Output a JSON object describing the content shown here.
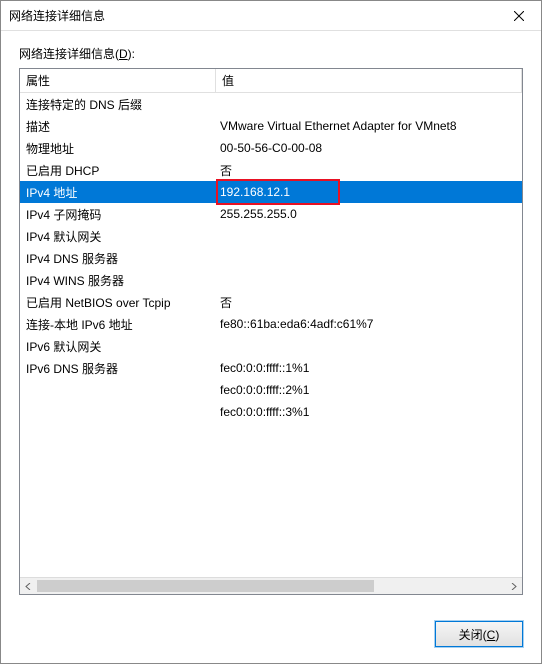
{
  "window": {
    "title": "网络连接详细信息",
    "close_label": "Close"
  },
  "label": {
    "text_pre": "网络连接详细信息(",
    "text_key": "D",
    "text_post": "):"
  },
  "columns": {
    "property": "属性",
    "value": "值"
  },
  "rows": [
    {
      "prop": "连接特定的 DNS 后缀",
      "val": "",
      "selected": false
    },
    {
      "prop": "描述",
      "val": "VMware Virtual Ethernet Adapter for VMnet8",
      "selected": false
    },
    {
      "prop": "物理地址",
      "val": "00-50-56-C0-00-08",
      "selected": false
    },
    {
      "prop": "已启用 DHCP",
      "val": "否",
      "selected": false
    },
    {
      "prop": "IPv4 地址",
      "val": "192.168.12.1",
      "selected": true,
      "highlight": true
    },
    {
      "prop": "IPv4 子网掩码",
      "val": "255.255.255.0",
      "selected": false
    },
    {
      "prop": "IPv4 默认网关",
      "val": "",
      "selected": false
    },
    {
      "prop": "IPv4 DNS 服务器",
      "val": "",
      "selected": false
    },
    {
      "prop": "IPv4 WINS 服务器",
      "val": "",
      "selected": false
    },
    {
      "prop": "已启用 NetBIOS over Tcpip",
      "val": "否",
      "selected": false
    },
    {
      "prop": "连接-本地 IPv6 地址",
      "val": "fe80::61ba:eda6:4adf:c61%7",
      "selected": false
    },
    {
      "prop": "IPv6 默认网关",
      "val": "",
      "selected": false
    },
    {
      "prop": "IPv6 DNS 服务器",
      "val": "fec0:0:0:ffff::1%1",
      "selected": false
    },
    {
      "prop": "",
      "val": "fec0:0:0:ffff::2%1",
      "selected": false
    },
    {
      "prop": "",
      "val": "fec0:0:0:ffff::3%1",
      "selected": false
    }
  ],
  "footer": {
    "close_pre": "关闭(",
    "close_key": "C",
    "close_post": ")"
  },
  "colors": {
    "selection": "#0078d7",
    "highlight_border": "#e81123"
  }
}
